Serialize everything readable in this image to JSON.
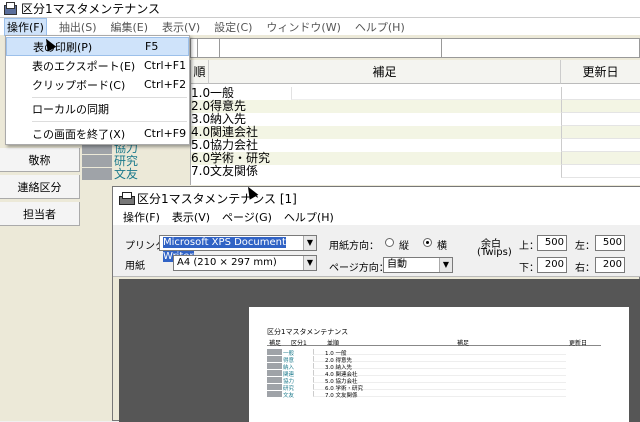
{
  "main_window": {
    "title": "区分1マスタメンテナンス",
    "menu": [
      "操作(F)",
      "抽出(S)",
      "編集(E)",
      "表示(V)",
      "設定(C)",
      "ウィンドウ(W)",
      "ヘルプ(H)"
    ]
  },
  "dropdown": {
    "items": [
      {
        "label": "表の印刷(P)",
        "shortcut": "F5"
      },
      {
        "label": "表のエクスポート(E)",
        "shortcut": "Ctrl+F1"
      },
      {
        "label": "クリップボード(C)",
        "shortcut": "Ctrl+F2"
      },
      {
        "label": "ローカルの同期",
        "shortcut": ""
      },
      {
        "label": "この画面を終了(X)",
        "shortcut": "Ctrl+F9"
      }
    ]
  },
  "grid": {
    "headers": {
      "order": "順",
      "note": "補足",
      "updated": "更新日"
    },
    "rows": [
      {
        "num": "1.0",
        "name": "一般"
      },
      {
        "num": "2.0",
        "name": "得意先"
      },
      {
        "num": "3.0",
        "name": "納入先"
      },
      {
        "num": "4.0",
        "name": "関連会社"
      },
      {
        "num": "5.0",
        "name": "協力会社"
      },
      {
        "num": "6.0",
        "name": "学術・研究"
      },
      {
        "num": "7.0",
        "name": "文友関係"
      }
    ],
    "left_names": [
      "協力",
      "研究",
      "文友"
    ]
  },
  "side_buttons": [
    "敬称",
    "連絡区分",
    "担当者"
  ],
  "print_window": {
    "title": "区分1マスタメンテナンス [1]",
    "menu": [
      "操作(F)",
      "表示(V)",
      "ページ(G)",
      "ヘルプ(H)"
    ],
    "printer_label": "プリンタ",
    "printer_value": "Microsoft XPS Document Writer",
    "paper_label": "用紙",
    "paper_value": "A4 (210 × 297 mm)",
    "paper_dir_label": "用紙方向：",
    "portrait": "縦",
    "landscape": "横",
    "page_dir_label": "ページ方向：",
    "page_dir_value": "自動",
    "margin_label": "余白",
    "margin_unit": "(Twips)",
    "top_label": "上：",
    "top_value": "500",
    "left_label": "左：",
    "left_value": "500",
    "bottom_label": "下：",
    "bottom_value": "200",
    "right_label": "右：",
    "right_value": "200"
  },
  "preview": {
    "title": "区分1マスタメンテナンス",
    "headers": {
      "kubun": "補足",
      "kubun1": "区分1",
      "order": "並順",
      "note": "補足",
      "updated": "更新日"
    },
    "rows": [
      {
        "name": "一般",
        "value": "1.0 一般"
      },
      {
        "name": "得意",
        "value": "2.0 得意先"
      },
      {
        "name": "納入",
        "value": "3.0 納入先"
      },
      {
        "name": "関連",
        "value": "4.0 関連会社"
      },
      {
        "name": "協力",
        "value": "5.0 協力会社"
      },
      {
        "name": "研究",
        "value": "6.0 学術・研究"
      },
      {
        "name": "文友",
        "value": "7.0 文友関係"
      }
    ]
  }
}
